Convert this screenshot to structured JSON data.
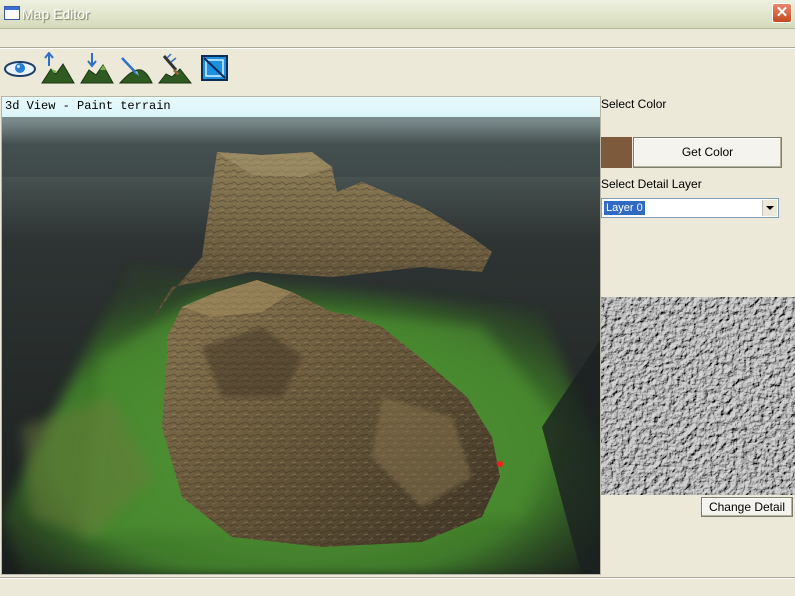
{
  "window": {
    "title": "Map Editor",
    "close_label": "✕"
  },
  "toolbar": {
    "tools": [
      {
        "name": "view-eye-tool",
        "icon": "eye-icon"
      },
      {
        "name": "raise-terrain-tool",
        "icon": "terrain-raise-icon"
      },
      {
        "name": "lower-terrain-tool",
        "icon": "terrain-lower-icon"
      },
      {
        "name": "smooth-terrain-tool",
        "icon": "terrain-smooth-icon"
      },
      {
        "name": "paint-terrain-tool",
        "icon": "terrain-paint-icon"
      },
      {
        "name": "select-area-tool",
        "icon": "select-box-icon"
      }
    ]
  },
  "viewport": {
    "label": "3d View - Paint terrain"
  },
  "panel": {
    "select_color_label": "Select Color",
    "color_swatch": "#7d5a3c",
    "get_color_button": "Get Color",
    "select_detail_layer_label": "Select Detail Layer",
    "detail_layer_value": "Layer 0",
    "change_detail_button": "Change Detail"
  }
}
